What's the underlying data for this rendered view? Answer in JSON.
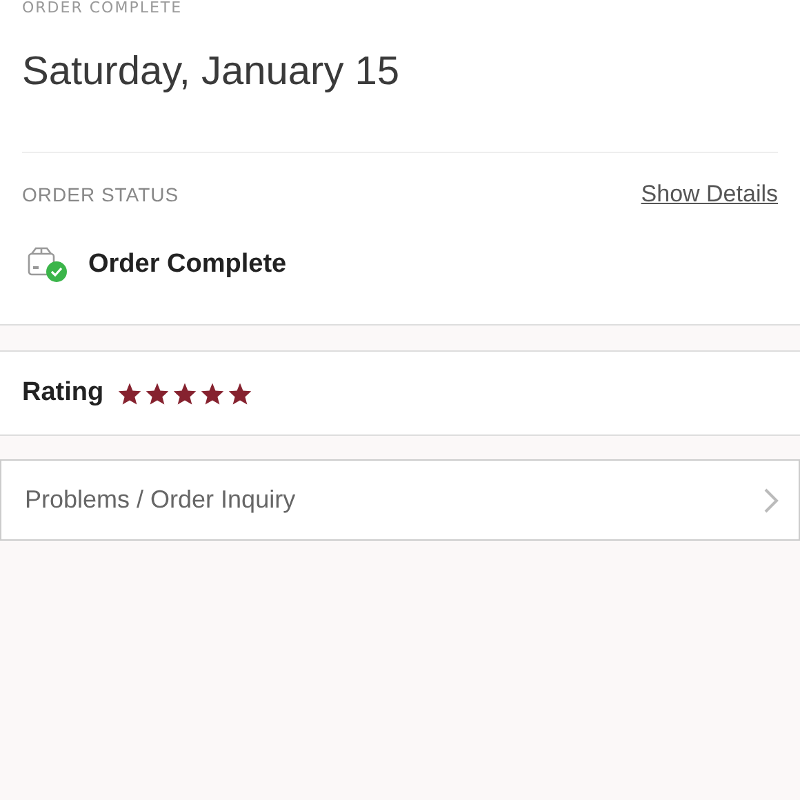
{
  "section_label": "ORDER COMPLETE",
  "date": "Saturday, January 15",
  "order_status": {
    "label": "ORDER STATUS",
    "link": "Show Details",
    "status": "Order Complete",
    "complete": true
  },
  "rating": {
    "label": "Rating",
    "stars": 5
  },
  "menu_items": [
    {
      "label": "Problems / Order Inquiry"
    }
  ]
}
